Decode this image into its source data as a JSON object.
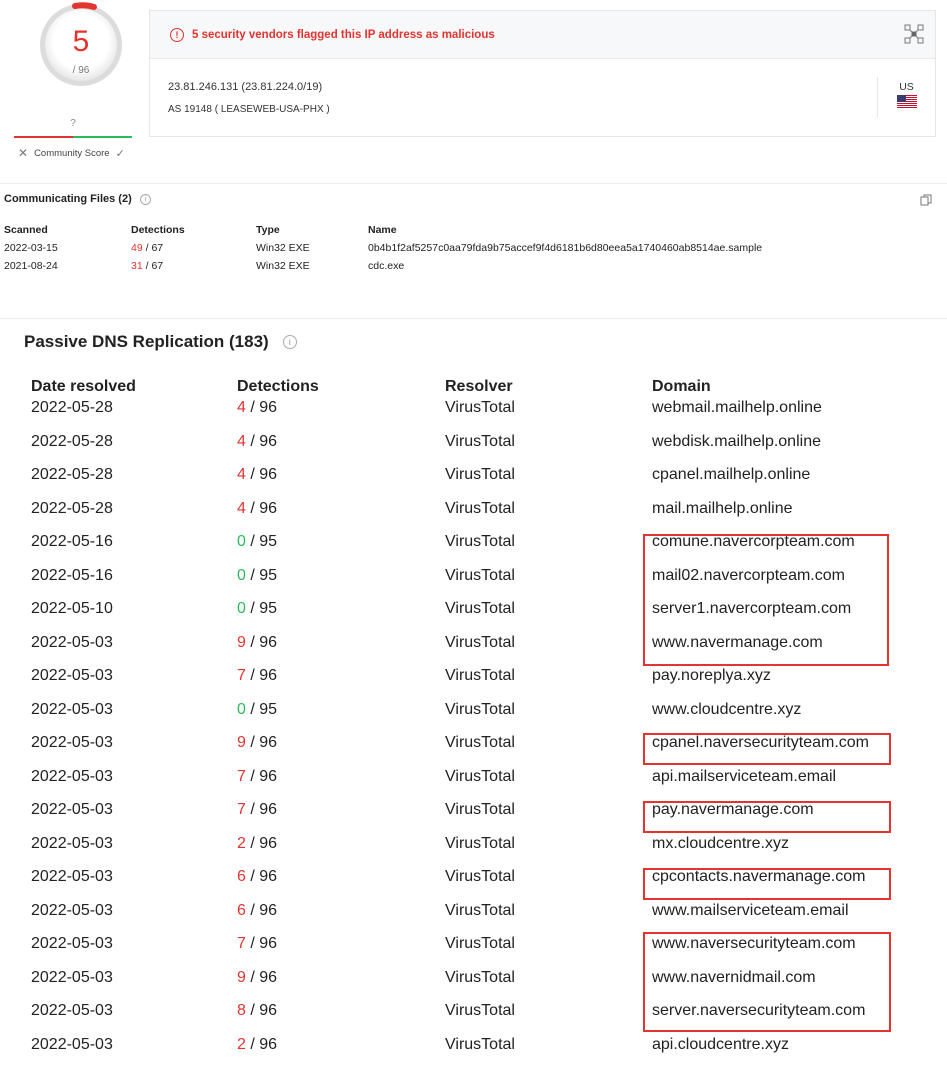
{
  "score": {
    "detections": "5",
    "total": "/ 96",
    "community_unknown": "?",
    "community_label": "Community Score",
    "colors": {
      "malicious": "#e3342f",
      "harmless": "#2eb85c"
    }
  },
  "alert": {
    "icon": "exclamation-circle-icon",
    "text": "5 security vendors flagged this IP address as malicious"
  },
  "ip_info": {
    "ip_line": "23.81.246.131  (23.81.224.0/19)",
    "as_line": "AS 19148 ( LEASEWEB-USA-PHX )",
    "country": "US"
  },
  "communicating_files": {
    "title": "Communicating Files (2)",
    "columns": [
      "Scanned",
      "Detections",
      "Type",
      "Name"
    ],
    "rows": [
      {
        "scanned": "2022-03-15",
        "det_hit": "49",
        "det_total": " / 67",
        "type": "Win32 EXE",
        "name": "0b4b1f2af5257c0aa79fda9b75accef9f4d6181b6d80eea5a1740460ab8514ae.sample"
      },
      {
        "scanned": "2021-08-24",
        "det_hit": "31",
        "det_total": " / 67",
        "type": "Win32 EXE",
        "name": "cdc.exe"
      }
    ]
  },
  "passive_dns": {
    "title": "Passive DNS Replication (183)",
    "columns": [
      "Date resolved",
      "Detections",
      "Resolver",
      "Domain"
    ],
    "rows": [
      {
        "date": "2022-05-28",
        "det_hit": "4",
        "det_total": " / 96",
        "resolver": "VirusTotal",
        "domain": "webmail.mailhelp.online"
      },
      {
        "date": "2022-05-28",
        "det_hit": "4",
        "det_total": " / 96",
        "resolver": "VirusTotal",
        "domain": "webdisk.mailhelp.online"
      },
      {
        "date": "2022-05-28",
        "det_hit": "4",
        "det_total": " / 96",
        "resolver": "VirusTotal",
        "domain": "cpanel.mailhelp.online"
      },
      {
        "date": "2022-05-28",
        "det_hit": "4",
        "det_total": " / 96",
        "resolver": "VirusTotal",
        "domain": "mail.mailhelp.online"
      },
      {
        "date": "2022-05-16",
        "det_hit": "0",
        "det_total": " / 95",
        "resolver": "VirusTotal",
        "domain": "comune.navercorpteam.com"
      },
      {
        "date": "2022-05-16",
        "det_hit": "0",
        "det_total": " / 95",
        "resolver": "VirusTotal",
        "domain": "mail02.navercorpteam.com"
      },
      {
        "date": "2022-05-10",
        "det_hit": "0",
        "det_total": " / 95",
        "resolver": "VirusTotal",
        "domain": "server1.navercorpteam.com"
      },
      {
        "date": "2022-05-03",
        "det_hit": "9",
        "det_total": " / 96",
        "resolver": "VirusTotal",
        "domain": "www.navermanage.com"
      },
      {
        "date": "2022-05-03",
        "det_hit": "7",
        "det_total": " / 96",
        "resolver": "VirusTotal",
        "domain": "pay.noreplya.xyz"
      },
      {
        "date": "2022-05-03",
        "det_hit": "0",
        "det_total": " / 95",
        "resolver": "VirusTotal",
        "domain": "www.cloudcentre.xyz"
      },
      {
        "date": "2022-05-03",
        "det_hit": "9",
        "det_total": " / 96",
        "resolver": "VirusTotal",
        "domain": "cpanel.naversecurityteam.com"
      },
      {
        "date": "2022-05-03",
        "det_hit": "7",
        "det_total": " / 96",
        "resolver": "VirusTotal",
        "domain": "api.mailserviceteam.email"
      },
      {
        "date": "2022-05-03",
        "det_hit": "7",
        "det_total": " / 96",
        "resolver": "VirusTotal",
        "domain": "pay.navermanage.com"
      },
      {
        "date": "2022-05-03",
        "det_hit": "2",
        "det_total": " / 96",
        "resolver": "VirusTotal",
        "domain": "mx.cloudcentre.xyz"
      },
      {
        "date": "2022-05-03",
        "det_hit": "6",
        "det_total": " / 96",
        "resolver": "VirusTotal",
        "domain": "cpcontacts.navermanage.com"
      },
      {
        "date": "2022-05-03",
        "det_hit": "6",
        "det_total": " / 96",
        "resolver": "VirusTotal",
        "domain": "www.mailserviceteam.email"
      },
      {
        "date": "2022-05-03",
        "det_hit": "7",
        "det_total": " / 96",
        "resolver": "VirusTotal",
        "domain": "www.naversecurityteam.com"
      },
      {
        "date": "2022-05-03",
        "det_hit": "9",
        "det_total": " / 96",
        "resolver": "VirusTotal",
        "domain": "www.navernidmail.com"
      },
      {
        "date": "2022-05-03",
        "det_hit": "8",
        "det_total": " / 96",
        "resolver": "VirusTotal",
        "domain": "server.naversecurityteam.com"
      },
      {
        "date": "2022-05-03",
        "det_hit": "2",
        "det_total": " / 96",
        "resolver": "VirusTotal",
        "domain": "api.cloudcentre.xyz"
      }
    ]
  }
}
